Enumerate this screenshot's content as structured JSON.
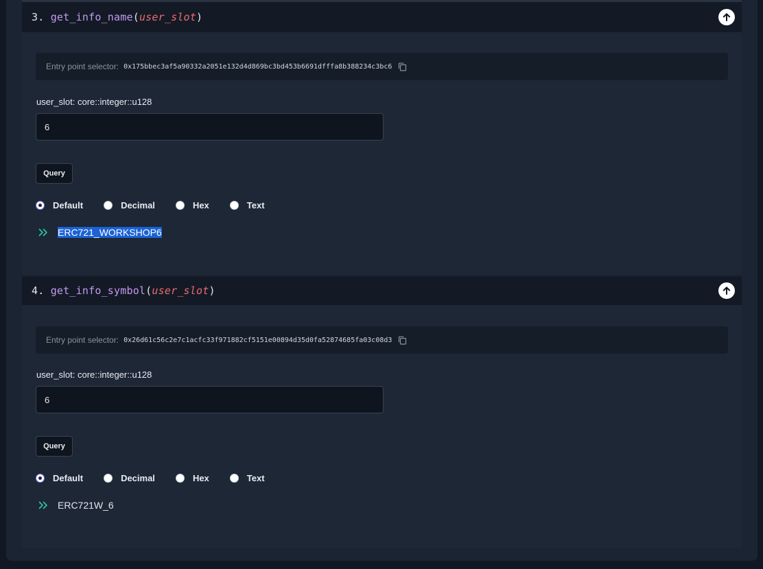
{
  "functions": [
    {
      "index": "3.",
      "name": "get_info_name",
      "param": "user_slot",
      "selector_label": "Entry point selector:",
      "selector_value": "0x175bbec3af5a90332a2051e132d4d869bc3bd453b6691dfffa8b388234c3bc6",
      "field_label": "user_slot: core::integer::u128",
      "field_value": "6",
      "query_label": "Query",
      "radio_options": [
        "Default",
        "Decimal",
        "Hex",
        "Text"
      ],
      "radio_selected": "Default",
      "result": "ERC721_WORKSHOP6"
    },
    {
      "index": "4.",
      "name": "get_info_symbol",
      "param": "user_slot",
      "selector_label": "Entry point selector:",
      "selector_value": "0x26d61c56c2e7c1acfc33f971882cf5151e00894d35d0fa52874685fa03c08d3",
      "field_label": "user_slot: core::integer::u128",
      "field_value": "6",
      "query_label": "Query",
      "radio_options": [
        "Default",
        "Decimal",
        "Hex",
        "Text"
      ],
      "radio_selected": "Default",
      "result": "ERC721W_6"
    }
  ],
  "icons": {
    "collapse": "arrow-up-circle-icon",
    "copy": "copy-icon",
    "result": "double-chevron-right-icon"
  },
  "colors": {
    "function_name": "#c39bef",
    "param": "#ef6b6f",
    "result_chevron": "#2fc8a6",
    "selection": "#1a62d6"
  }
}
